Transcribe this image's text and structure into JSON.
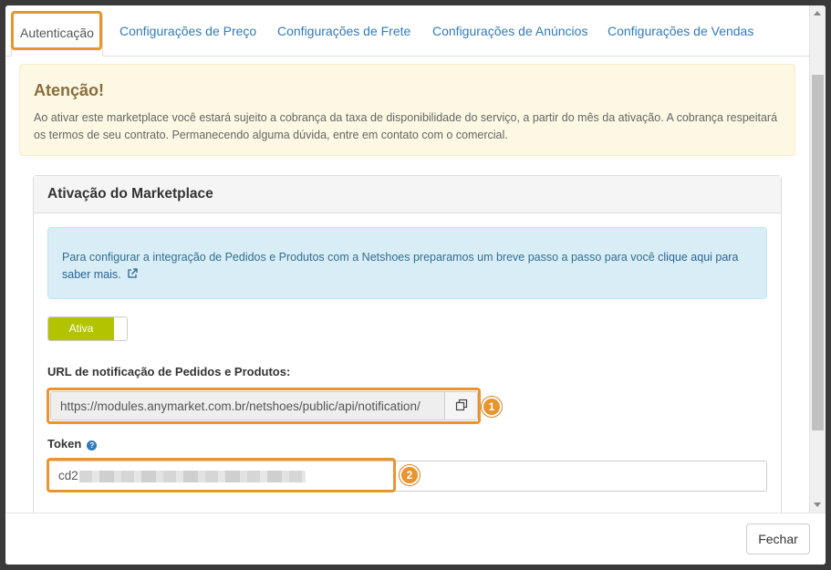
{
  "tabs": [
    {
      "label": "Autenticação"
    },
    {
      "label": "Configurações de Preço"
    },
    {
      "label": "Configurações de Frete"
    },
    {
      "label": "Configurações de Anúncios"
    },
    {
      "label": "Configurações de Vendas"
    }
  ],
  "warning": {
    "title": "Atenção!",
    "text": "Ao ativar este marketplace você estará sujeito a cobrança da taxa de disponibilidade do serviço, a partir do mês da ativação. A cobrança respeitará os termos de seu contrato. Permanecendo alguma dúvida, entre em contato com o comercial."
  },
  "panel": {
    "title": "Ativação do Marketplace",
    "info_text": "Para configurar a integração de Pedidos e Produtos com a Netshoes preparamos um breve passo a passo para você ",
    "info_link": "clique aqui para saber mais.",
    "toggle_label": "Ativa",
    "url_label": "URL de notificação de Pedidos e Produtos:",
    "url_value": "https://modules.anymarket.com.br/netshoes/public/api/notification/",
    "token_label": "Token",
    "token_value_prefix": "cd2"
  },
  "badges": {
    "first": "1",
    "second": "2"
  },
  "footer": {
    "close_label": "Fechar"
  },
  "colors": {
    "highlight": "#e8942f",
    "toggle_on": "#b3c300",
    "link": "#337ab7"
  }
}
